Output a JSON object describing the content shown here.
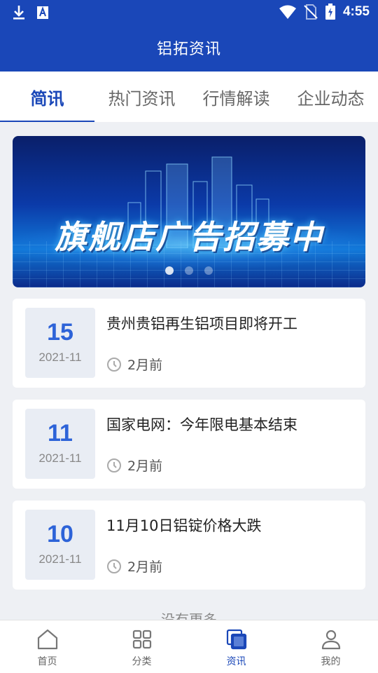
{
  "status_bar": {
    "time": "4:55",
    "icons_left": [
      "download-icon",
      "font-a-icon"
    ],
    "icons_right": [
      "wifi-icon",
      "no-sim-icon",
      "battery-charging-icon"
    ]
  },
  "header": {
    "title": "铝拓资讯"
  },
  "tabs": [
    {
      "label": "简讯",
      "active": true
    },
    {
      "label": "热门资讯",
      "active": false
    },
    {
      "label": "行情解读",
      "active": false
    },
    {
      "label": "企业动态",
      "active": false
    }
  ],
  "banner": {
    "text": "旗舰店广告招募中",
    "slide_count": 3,
    "active_slide": 1
  },
  "news": [
    {
      "day": "15",
      "year_month": "2021-11",
      "title": "贵州贵铝再生铝项目即将开工",
      "time_ago": "2月前"
    },
    {
      "day": "11",
      "year_month": "2021-11",
      "title": "国家电网：今年限电基本结束",
      "time_ago": "2月前"
    },
    {
      "day": "10",
      "year_month": "2021-11",
      "title": "11月10日铝锭价格大跌",
      "time_ago": "2月前"
    }
  ],
  "footer_text": "没有更多",
  "bottom_nav": [
    {
      "label": "首页",
      "icon": "home-icon",
      "active": false
    },
    {
      "label": "分类",
      "icon": "grid-icon",
      "active": false
    },
    {
      "label": "资讯",
      "icon": "news-icon",
      "active": true
    },
    {
      "label": "我的",
      "icon": "user-icon",
      "active": false
    }
  ],
  "colors": {
    "primary": "#1a47b8",
    "date_number": "#2d63d8",
    "page_bg": "#eef0f4"
  }
}
